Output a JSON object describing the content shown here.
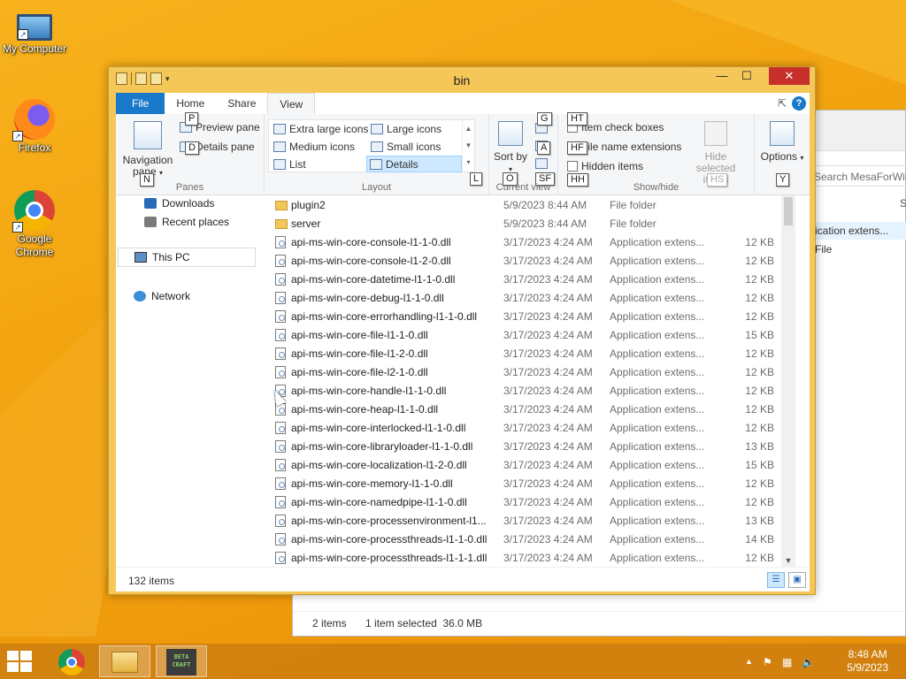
{
  "desktop": {
    "icons": [
      {
        "label": "My Computer"
      },
      {
        "label": "Firefox"
      },
      {
        "label": "Google Chrome"
      }
    ]
  },
  "background_window": {
    "search_placeholder": "Search MesaForWin",
    "partial_letter": "S",
    "selected_row_type": "ication extens...",
    "row_type2": "File",
    "status_items": "2 items",
    "status_selected": "1 item selected  36.0 MB"
  },
  "window": {
    "title": "bin",
    "controls": {
      "minimize": "—",
      "maximize": "☐",
      "close": "✕"
    },
    "tabs": [
      {
        "label": "File"
      },
      {
        "label": "Home"
      },
      {
        "label": "Share"
      },
      {
        "label": "View"
      }
    ],
    "help": "?"
  },
  "ribbon": {
    "panes": {
      "label": "Panes",
      "nav_pane": "Navigation pane",
      "preview_pane": "Preview pane",
      "details_pane": "Details pane",
      "keytips": {
        "nav": "N",
        "preview": "P",
        "details": "D"
      }
    },
    "layout": {
      "label": "Layout",
      "options": [
        "Extra large icons",
        "Large icons",
        "Medium icons",
        "Small icons",
        "List",
        "Details"
      ],
      "selected": "Details",
      "keytip": "L"
    },
    "current_view": {
      "label": "Current view",
      "sort_by": "Sort by",
      "keytips": {
        "sort": "O",
        "g": "G",
        "a": "A",
        "sf": "SF"
      }
    },
    "show_hide": {
      "label": "Show/hide",
      "item_check_boxes": "Item check boxes",
      "file_name_extensions": "File name extensions",
      "hidden_items": "Hidden items",
      "hide_selected": "Hide selected items",
      "keytips": {
        "ht": "HT",
        "hf": "HF",
        "hh": "HH",
        "hs": "HS"
      }
    },
    "options": {
      "label": "Options",
      "keytip": "Y"
    }
  },
  "nav_pane": {
    "items": [
      "Downloads",
      "Recent places",
      "This PC",
      "Network"
    ]
  },
  "files": [
    {
      "name": "plugin2",
      "date": "5/9/2023 8:44 AM",
      "type": "File folder",
      "size": "",
      "kind": "folder"
    },
    {
      "name": "server",
      "date": "5/9/2023 8:44 AM",
      "type": "File folder",
      "size": "",
      "kind": "folder"
    },
    {
      "name": "api-ms-win-core-console-l1-1-0.dll",
      "date": "3/17/2023 4:24 AM",
      "type": "Application extens...",
      "size": "12 KB",
      "kind": "dll"
    },
    {
      "name": "api-ms-win-core-console-l1-2-0.dll",
      "date": "3/17/2023 4:24 AM",
      "type": "Application extens...",
      "size": "12 KB",
      "kind": "dll"
    },
    {
      "name": "api-ms-win-core-datetime-l1-1-0.dll",
      "date": "3/17/2023 4:24 AM",
      "type": "Application extens...",
      "size": "12 KB",
      "kind": "dll"
    },
    {
      "name": "api-ms-win-core-debug-l1-1-0.dll",
      "date": "3/17/2023 4:24 AM",
      "type": "Application extens...",
      "size": "12 KB",
      "kind": "dll"
    },
    {
      "name": "api-ms-win-core-errorhandling-l1-1-0.dll",
      "date": "3/17/2023 4:24 AM",
      "type": "Application extens...",
      "size": "12 KB",
      "kind": "dll"
    },
    {
      "name": "api-ms-win-core-file-l1-1-0.dll",
      "date": "3/17/2023 4:24 AM",
      "type": "Application extens...",
      "size": "15 KB",
      "kind": "dll"
    },
    {
      "name": "api-ms-win-core-file-l1-2-0.dll",
      "date": "3/17/2023 4:24 AM",
      "type": "Application extens...",
      "size": "12 KB",
      "kind": "dll"
    },
    {
      "name": "api-ms-win-core-file-l2-1-0.dll",
      "date": "3/17/2023 4:24 AM",
      "type": "Application extens...",
      "size": "12 KB",
      "kind": "dll"
    },
    {
      "name": "api-ms-win-core-handle-l1-1-0.dll",
      "date": "3/17/2023 4:24 AM",
      "type": "Application extens...",
      "size": "12 KB",
      "kind": "dll"
    },
    {
      "name": "api-ms-win-core-heap-l1-1-0.dll",
      "date": "3/17/2023 4:24 AM",
      "type": "Application extens...",
      "size": "12 KB",
      "kind": "dll"
    },
    {
      "name": "api-ms-win-core-interlocked-l1-1-0.dll",
      "date": "3/17/2023 4:24 AM",
      "type": "Application extens...",
      "size": "12 KB",
      "kind": "dll"
    },
    {
      "name": "api-ms-win-core-libraryloader-l1-1-0.dll",
      "date": "3/17/2023 4:24 AM",
      "type": "Application extens...",
      "size": "13 KB",
      "kind": "dll"
    },
    {
      "name": "api-ms-win-core-localization-l1-2-0.dll",
      "date": "3/17/2023 4:24 AM",
      "type": "Application extens...",
      "size": "15 KB",
      "kind": "dll"
    },
    {
      "name": "api-ms-win-core-memory-l1-1-0.dll",
      "date": "3/17/2023 4:24 AM",
      "type": "Application extens...",
      "size": "12 KB",
      "kind": "dll"
    },
    {
      "name": "api-ms-win-core-namedpipe-l1-1-0.dll",
      "date": "3/17/2023 4:24 AM",
      "type": "Application extens...",
      "size": "12 KB",
      "kind": "dll"
    },
    {
      "name": "api-ms-win-core-processenvironment-l1...",
      "date": "3/17/2023 4:24 AM",
      "type": "Application extens...",
      "size": "13 KB",
      "kind": "dll"
    },
    {
      "name": "api-ms-win-core-processthreads-l1-1-0.dll",
      "date": "3/17/2023 4:24 AM",
      "type": "Application extens...",
      "size": "14 KB",
      "kind": "dll"
    },
    {
      "name": "api-ms-win-core-processthreads-l1-1-1.dll",
      "date": "3/17/2023 4:24 AM",
      "type": "Application extens...",
      "size": "12 KB",
      "kind": "dll"
    }
  ],
  "status": {
    "item_count": "132 items"
  },
  "taskbar": {
    "apps": [
      "chrome",
      "file-explorer",
      "minecraft"
    ],
    "craft_label": "BETA CRAFT",
    "time": "8:48 AM",
    "date": "5/9/2023"
  }
}
